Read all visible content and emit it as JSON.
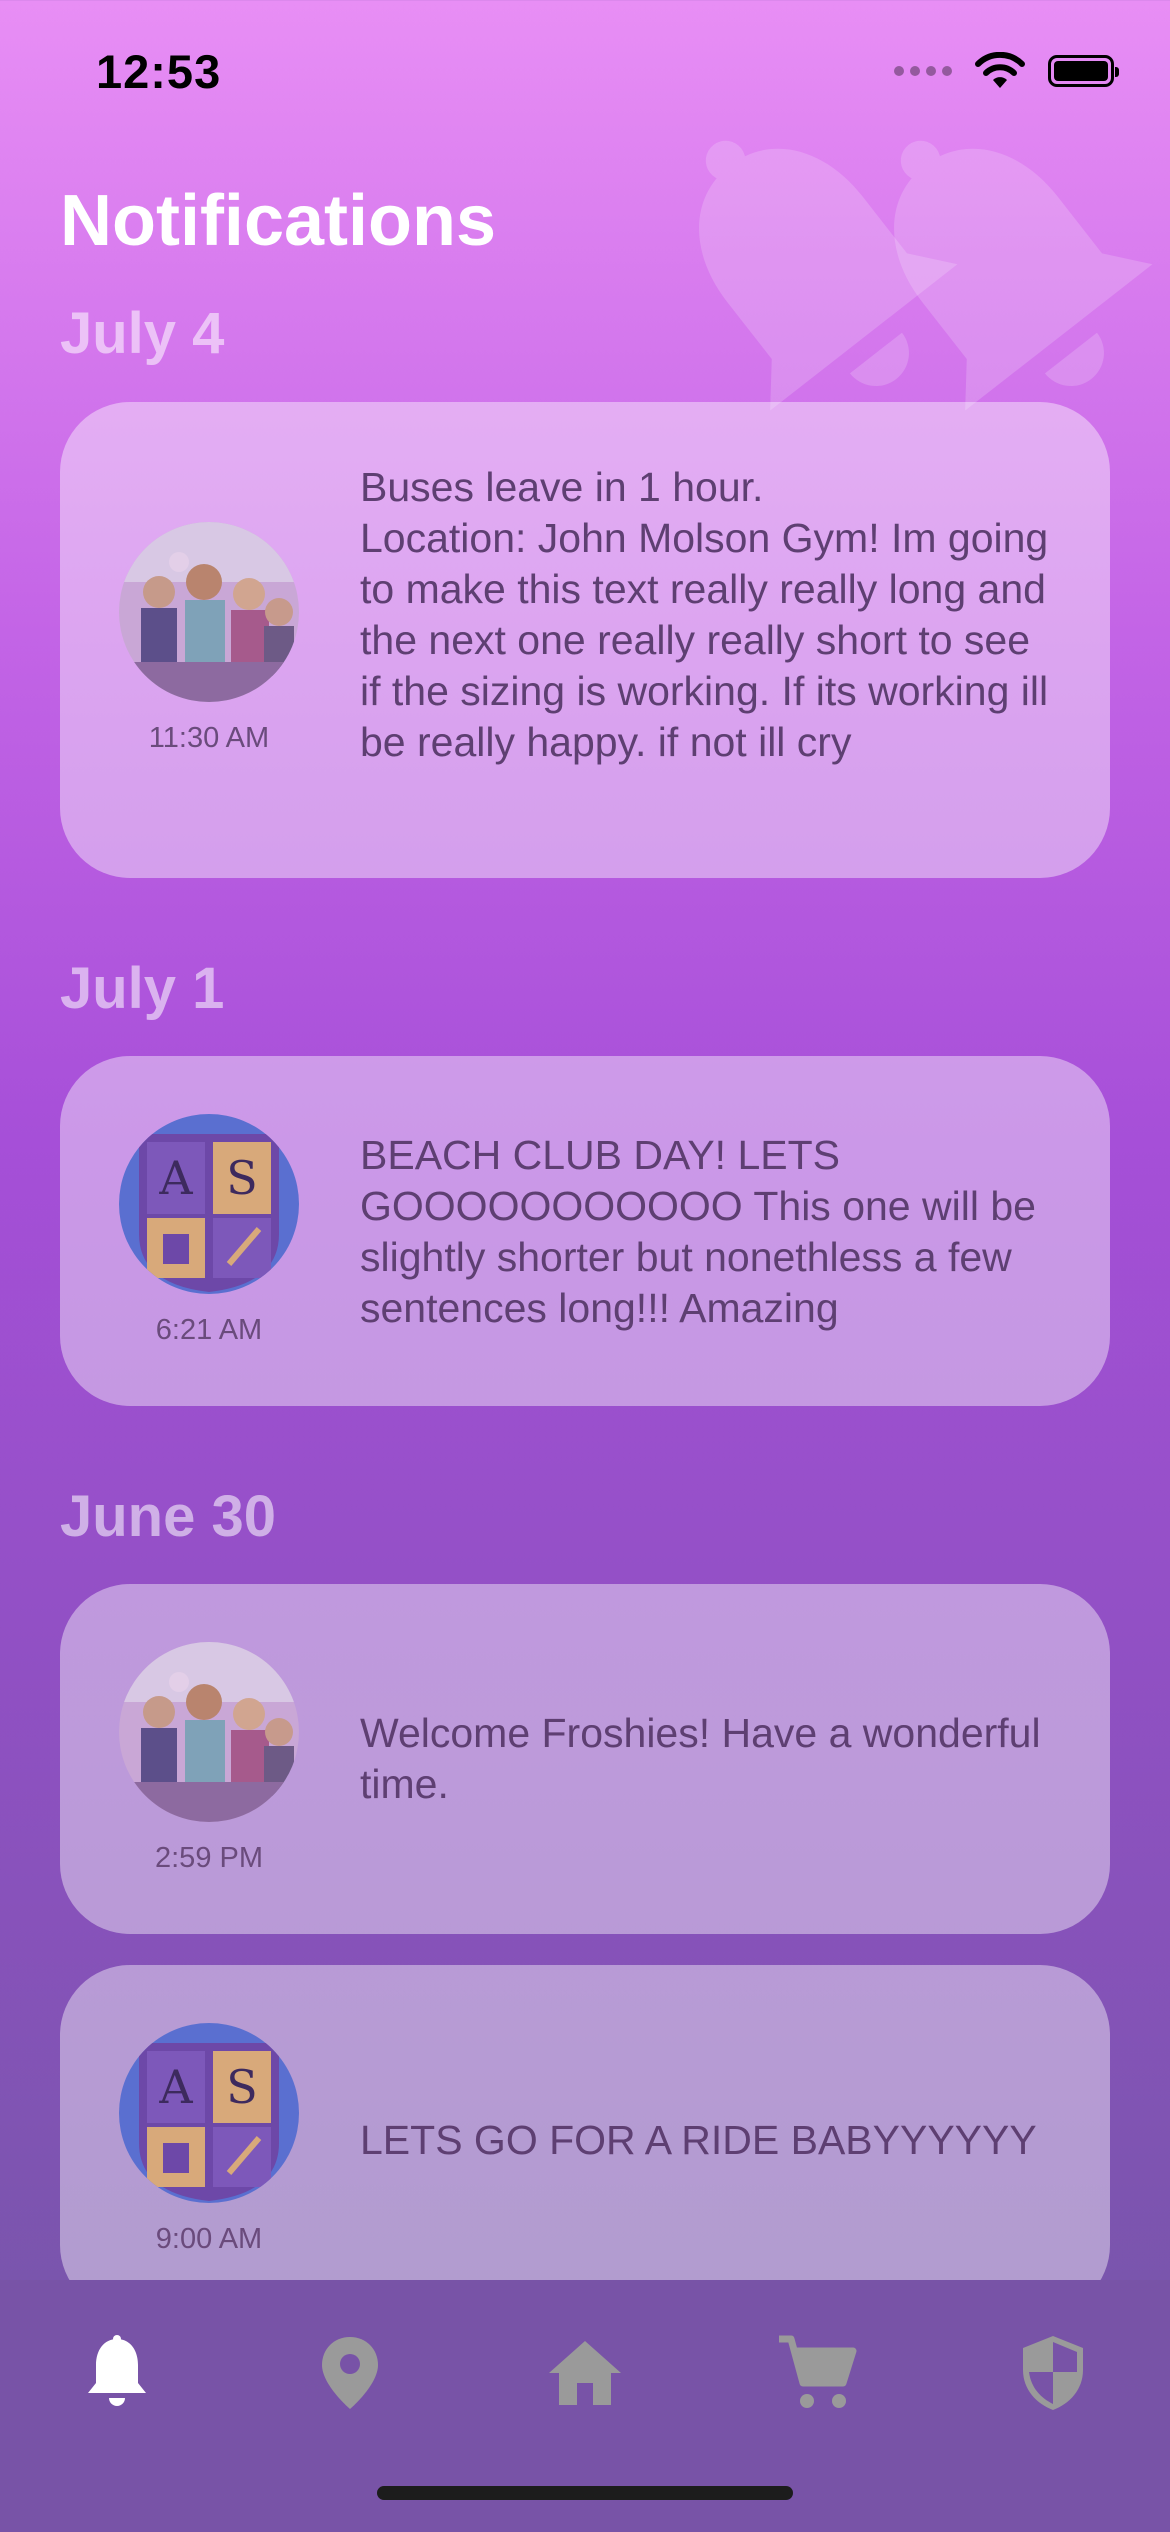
{
  "status": {
    "time": "12:53"
  },
  "page": {
    "title": "Notifications"
  },
  "notifications": [
    {
      "date": "July 4",
      "time": "11:30 AM",
      "avatar": "crowd-photo",
      "message": "Buses leave in 1 hour.\nLocation: John Molson Gym! Im going to make this text really really long and the next one really really short to see if the sizing is working. If its working ill be really happy. if not ill cry"
    },
    {
      "date": "July 1",
      "time": "6:21 AM",
      "avatar": "crest-logo",
      "message": "BEACH CLUB DAY! LETS GOOOOOOOOOOO This one will be slightly shorter but nonethless a few sentences long!!! Amazing"
    },
    {
      "date": "June 30",
      "time": "2:59 PM",
      "avatar": "crowd-photo",
      "message": "Welcome Froshies! Have a wonderful time."
    },
    {
      "date": "",
      "time": "9:00 AM",
      "avatar": "crest-logo",
      "message": "LETS GO FOR A RIDE BABYYYYYY"
    }
  ],
  "crest": {
    "letter_a": "A",
    "letter_s": "S"
  },
  "tabbar": {
    "tabs": [
      {
        "icon": "bell-icon",
        "active": true
      },
      {
        "icon": "location-pin-icon",
        "active": false
      },
      {
        "icon": "home-icon",
        "active": false
      },
      {
        "icon": "cart-icon",
        "active": false
      },
      {
        "icon": "shield-icon",
        "active": false
      }
    ]
  },
  "colors": {
    "active_tab": "#ffffff",
    "inactive_tab": "#9a9a9a",
    "message_text": "#5e3f72"
  }
}
